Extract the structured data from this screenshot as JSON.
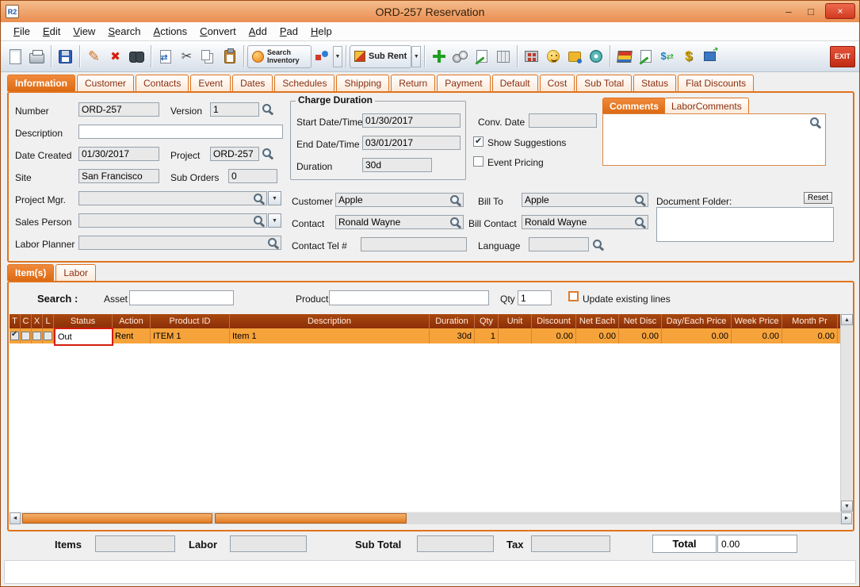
{
  "window": {
    "title": "ORD-257 Reservation",
    "icon_text": "R2",
    "minimize_glyph": "–",
    "maximize_glyph": "□",
    "close_glyph": "×"
  },
  "menu": {
    "items": [
      "File",
      "Edit",
      "View",
      "Search",
      "Actions",
      "Convert",
      "Add",
      "Pad",
      "Help"
    ]
  },
  "toolbar": {
    "search_inventory": "Search Inventory",
    "sub_rent": "Sub Rent",
    "exit": "EXIT"
  },
  "tabs": {
    "items": [
      "Information",
      "Customer",
      "Contacts",
      "Event",
      "Dates",
      "Schedules",
      "Shipping",
      "Return",
      "Payment",
      "Default",
      "Cost",
      "Sub Total",
      "Status",
      "Flat Discounts"
    ],
    "selected": "Information"
  },
  "info": {
    "number_label": "Number",
    "number_value": "ORD-257",
    "version_label": "Version",
    "version_value": "1",
    "description_label": "Description",
    "description_value": "",
    "date_created_label": "Date Created",
    "date_created_value": "01/30/2017",
    "project_label": "Project",
    "project_value": "ORD-257",
    "site_label": "Site",
    "site_value": "San Francisco",
    "sub_orders_label": "Sub Orders",
    "sub_orders_value": "0",
    "project_mgr_label": "Project Mgr.",
    "project_mgr_value": "",
    "sales_person_label": "Sales Person",
    "sales_person_value": "",
    "labor_planner_label": "Labor Planner",
    "labor_planner_value": "",
    "charge": {
      "title": "Charge Duration",
      "start_label": "Start Date/Time",
      "start_value": "01/30/2017",
      "end_label": "End Date/Time",
      "end_value": "03/01/2017",
      "duration_label": "Duration",
      "duration_value": "30d"
    },
    "conv_date_label": "Conv. Date",
    "conv_date_value": "",
    "show_suggestions_label": "Show Suggestions",
    "show_suggestions_checked": true,
    "event_pricing_label": "Event Pricing",
    "event_pricing_checked": false,
    "customer_label": "Customer",
    "customer_value": "Apple",
    "bill_to_label": "Bill To",
    "bill_to_value": "Apple",
    "contact_label": "Contact",
    "contact_value": "Ronald Wayne",
    "bill_contact_label": "Bill Contact",
    "bill_contact_value": "Ronald Wayne",
    "contact_tel_label": "Contact Tel #",
    "contact_tel_value": "",
    "language_label": "Language",
    "language_value": "",
    "comments_tab": "Comments",
    "labor_comments_tab": "LaborComments",
    "comments_value": "",
    "document_folder_label": "Document Folder:",
    "reset_label": "Reset",
    "document_folder_value": ""
  },
  "items_section": {
    "tabs": [
      "Item(s)",
      "Labor"
    ],
    "selected_tab": "Item(s)",
    "search_label": "Search :",
    "asset_label": "Asset",
    "asset_value": "",
    "product_label": "Product",
    "product_value": "",
    "qty_label": "Qty",
    "qty_value": "1",
    "update_label": "Update existing lines",
    "update_checked": false
  },
  "table": {
    "columns": [
      "T",
      "C",
      "X",
      "L",
      "Status",
      "Action",
      "Product ID",
      "Description",
      "Duration",
      "Qty",
      "Unit",
      "Discount",
      "Net Each",
      "Net Disc",
      "Day/Each Price",
      "Week Price",
      "Month Pr"
    ],
    "rows": [
      {
        "checks": [
          true,
          false,
          false,
          false
        ],
        "status": "Out",
        "action": "Rent",
        "product_id": "ITEM 1",
        "description": "Item 1",
        "duration": "30d",
        "qty": "1",
        "unit": "",
        "discount": "0.00",
        "net_each": "0.00",
        "net_disc": "0.00",
        "day_each": "0.00",
        "week": "0.00",
        "month": "0.00"
      }
    ]
  },
  "totals": {
    "items_label": "Items",
    "items_value": "",
    "labor_label": "Labor",
    "labor_value": "",
    "sub_total_label": "Sub Total",
    "sub_total_value": "",
    "tax_label": "Tax",
    "tax_value": "",
    "total_label": "Total",
    "total_value": "0.00"
  },
  "colors": {
    "accent_orange": "#e0731d",
    "header_maroon": "#8c2f08",
    "row_orange": "#f6a33c",
    "highlight_red": "#d41c0f"
  }
}
